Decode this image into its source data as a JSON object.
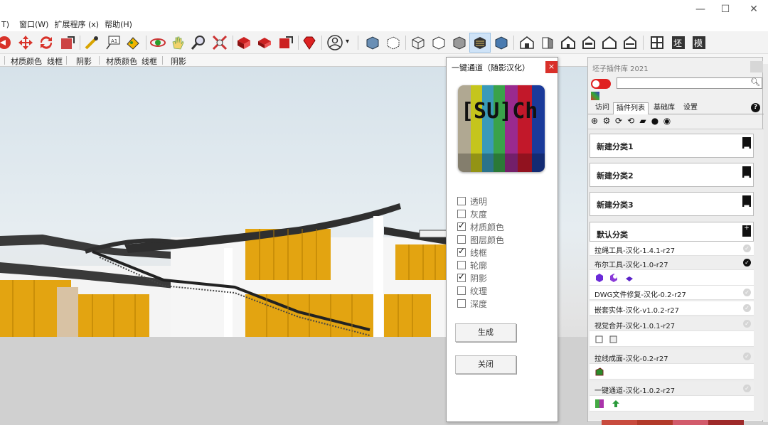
{
  "window": {
    "minimize": "—",
    "maximize": "☐",
    "close": "✕"
  },
  "menu": [
    "T)",
    "窗口(W)",
    "扩展程序 (x)",
    "帮助(H)"
  ],
  "labelbar": [
    "材质颜色",
    "线框",
    "阴影",
    "材质颜色",
    "线框",
    "阴影"
  ],
  "dialog": {
    "title": "一键通道（随影汉化）",
    "close": "×",
    "logo_text": "[SU]Ch",
    "options": [
      {
        "label": "透明",
        "checked": false
      },
      {
        "label": "灰度",
        "checked": false
      },
      {
        "label": "材质颜色",
        "checked": true
      },
      {
        "label": "图层颜色",
        "checked": false
      },
      {
        "label": "线框",
        "checked": true
      },
      {
        "label": "轮廓",
        "checked": false
      },
      {
        "label": "阴影",
        "checked": true
      },
      {
        "label": "纹理",
        "checked": false
      },
      {
        "label": "深度",
        "checked": false
      }
    ],
    "generate_button": "生成",
    "close_button": "关闭"
  },
  "panel": {
    "title": "坯子插件库 2021",
    "search_value": "",
    "tabs": [
      "访问",
      "插件列表",
      "基础库",
      "设置"
    ],
    "active_tab": "插件列表",
    "help": "?",
    "categories": [
      "新建分类1",
      "新建分类2",
      "新建分类3",
      "默认分类"
    ],
    "plugins": [
      {
        "name": "拉绳工具-汉化-1.4.1-r27",
        "on": false
      },
      {
        "name": "布尔工具-汉化-1.0-r27",
        "on": true
      },
      {
        "name": "DWG文件修复-汉化-0.2-r27",
        "on": false
      },
      {
        "name": "嵌套实体-汉化-v1.0.2-r27",
        "on": false
      },
      {
        "name": "视觉合并-汉化-1.0.1-r27",
        "on": false
      },
      {
        "name": "拉线成面-汉化-0.2-r27",
        "on": false
      },
      {
        "name": "一键通道-汉化-1.0.2-r27",
        "on": false
      }
    ]
  },
  "colors": {
    "accent": "#d9302a",
    "building_yellow": "#e3a411",
    "roof": "#3a3a3a"
  }
}
